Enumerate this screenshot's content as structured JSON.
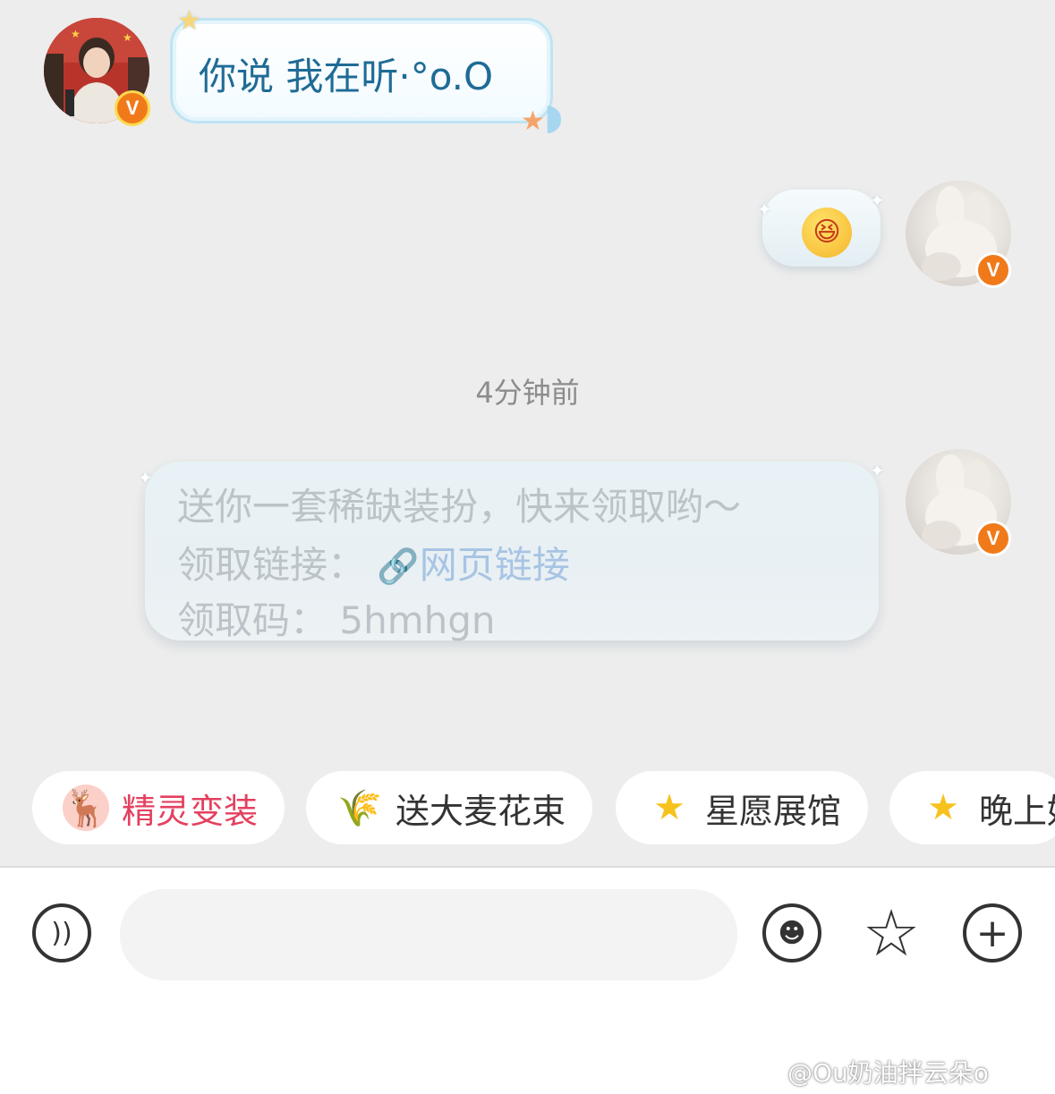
{
  "messages": {
    "first": {
      "text": "你说 我在听·°o.O"
    },
    "timestamp": "4分钟前",
    "gift": {
      "line1": "送你一套稀缺装扮，快来领取哟～",
      "link_label": "领取链接：",
      "link_text": "网页链接",
      "code_label": "领取码：",
      "code_value": "5hmhgn"
    }
  },
  "badges": {
    "verified": "V"
  },
  "shortcuts": [
    {
      "label": "精灵变装",
      "icon": "deer-mascot-icon",
      "color": "#e4405f"
    },
    {
      "label": "送大麦花束",
      "icon": "wheat-icon"
    },
    {
      "label": "星愿展馆",
      "icon": "star-face-icon"
    },
    {
      "label": "晚上好",
      "icon": "star-face-icon"
    }
  ],
  "composer": {
    "placeholder": ""
  },
  "watermark": "@Ou奶油拌云朵o",
  "colors": {
    "accent": "#f07a1a",
    "bubble_border": "#bfe4f3",
    "link": "#a7c4e4"
  }
}
